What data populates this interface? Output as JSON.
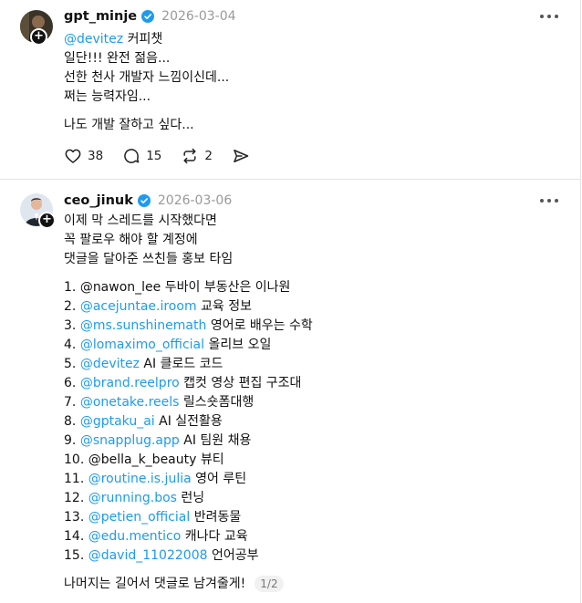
{
  "posts": [
    {
      "username": "gpt_minje",
      "timestamp": "2026-03-04",
      "lines": [
        "커피챗",
        "일단!!! 완전 젊음...",
        "선한 천사 개발자 느낌이신데...",
        "쩌는 능력자임...",
        "나도 개발 잘하고 싶다..."
      ],
      "mention": "@devitez",
      "likes": "38",
      "replies": "15",
      "reposts": "2"
    },
    {
      "username": "ceo_jinuk",
      "timestamp": "2026-03-06",
      "intro": [
        "이제 막 스레드를 시작했다면",
        "꼭 팔로우 해야 할 계정에",
        "댓글을 달아준 쓰친들 홍보 타임"
      ],
      "list": [
        {
          "num": "1.",
          "handle": "@nawon_lee",
          "desc": "두바이 부동산은 이나원",
          "link": false
        },
        {
          "num": "2.",
          "handle": "@acejuntae.iroom",
          "desc": "교육 정보",
          "link": true
        },
        {
          "num": "3.",
          "handle": "@ms.sunshinemath",
          "desc": "영어로 배우는 수학",
          "link": true
        },
        {
          "num": "4.",
          "handle": "@lomaximo_official",
          "desc": "올리브 오일",
          "link": true
        },
        {
          "num": "5.",
          "handle": "@devitez",
          "desc": "AI 클로드 코드",
          "link": true
        },
        {
          "num": "6.",
          "handle": "@brand.reelpro",
          "desc": "캡컷 영상 편집 구조대",
          "link": true
        },
        {
          "num": "7.",
          "handle": "@onetake.reels",
          "desc": "릴스숏폼대행",
          "link": true
        },
        {
          "num": "8.",
          "handle": "@gptaku_ai",
          "desc": "AI 실전활용",
          "link": true
        },
        {
          "num": "9.",
          "handle": "@snapplug.app",
          "desc": "AI 팀원 채용",
          "link": true
        },
        {
          "num": "10.",
          "handle": "@bella_k_beauty",
          "desc": "뷰티",
          "link": false
        },
        {
          "num": "11.",
          "handle": "@routine.is.julia",
          "desc": "영어 루틴",
          "link": true
        },
        {
          "num": "12.",
          "handle": "@running.bos",
          "desc": "런닝",
          "link": true
        },
        {
          "num": "13.",
          "handle": "@petien_official",
          "desc": "반려동물",
          "link": true
        },
        {
          "num": "14.",
          "handle": "@edu.mentico",
          "desc": "캐나다 교육",
          "link": true
        },
        {
          "num": "15.",
          "handle": "@david_11022008",
          "desc": "언어공부",
          "link": true
        }
      ],
      "outro": "나머지는 길어서 댓글로 남겨줄게!",
      "pager": "1/2"
    }
  ],
  "colors": {
    "link": "#1d9bf0",
    "timestamp": "#999999",
    "verified": "#1d9bf0"
  },
  "icons": [
    "heart-icon",
    "comment-icon",
    "repost-icon",
    "share-icon",
    "verified-icon",
    "more-icon",
    "follow-plus-icon"
  ]
}
